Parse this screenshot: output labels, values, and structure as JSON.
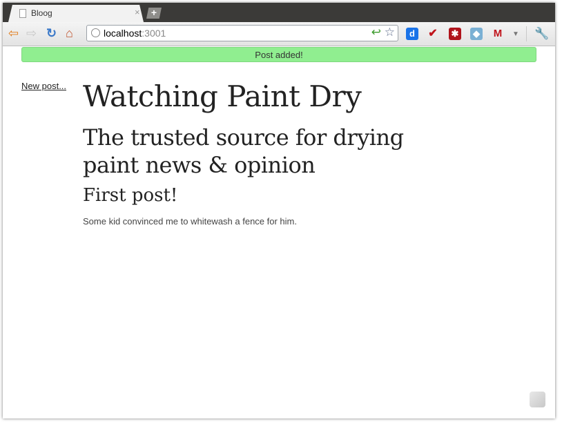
{
  "tab": {
    "title": "Bloog",
    "close": "×",
    "new_tab": "+"
  },
  "toolbar": {
    "back_icon": "back-arrow-icon",
    "forward_icon": "forward-arrow-icon",
    "reload_icon": "reload-icon",
    "home_icon": "home-icon",
    "url_host": "localhost",
    "url_port": ":3001",
    "extensions": [
      {
        "name": "delicious-extension-icon",
        "color": "#1a73e8",
        "glyph": "d"
      },
      {
        "name": "checkmark-extension-icon",
        "color": "#ffffff",
        "glyph": "✔"
      },
      {
        "name": "lastpass-extension-icon",
        "color": "#b0141c",
        "glyph": "✱"
      },
      {
        "name": "bird-extension-icon",
        "color": "#7ab0d4",
        "glyph": "◆"
      },
      {
        "name": "gmail-extension-icon",
        "color": "#ffffff",
        "glyph": "M"
      }
    ]
  },
  "page": {
    "flash": "Post added!",
    "new_post_link": "New post...",
    "title": "Watching Paint Dry",
    "subtitle": "The trusted source for drying paint news & opinion",
    "post": {
      "title": "First post!",
      "body": "Some kid convinced me to whitewash a fence for him."
    }
  },
  "colors": {
    "flash_bg": "#90ee90",
    "tabstrip": "#3b3a38"
  }
}
